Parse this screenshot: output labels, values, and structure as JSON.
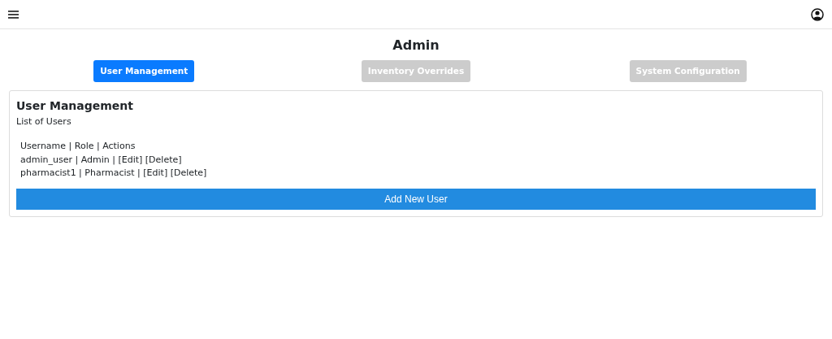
{
  "page_title": "Admin",
  "tabs": [
    {
      "label": "User Management",
      "selected": true
    },
    {
      "label": "Inventory Overrides",
      "selected": false
    },
    {
      "label": "System Configuration",
      "selected": false
    }
  ],
  "panel": {
    "title": "User Management",
    "subtitle": "List of Users",
    "lines": [
      "Username | Role | Actions",
      "admin_user | Admin | [Edit] [Delete]",
      "pharmacist1 | Pharmacist | [Edit] [Delete]"
    ],
    "button": "Add New User"
  }
}
